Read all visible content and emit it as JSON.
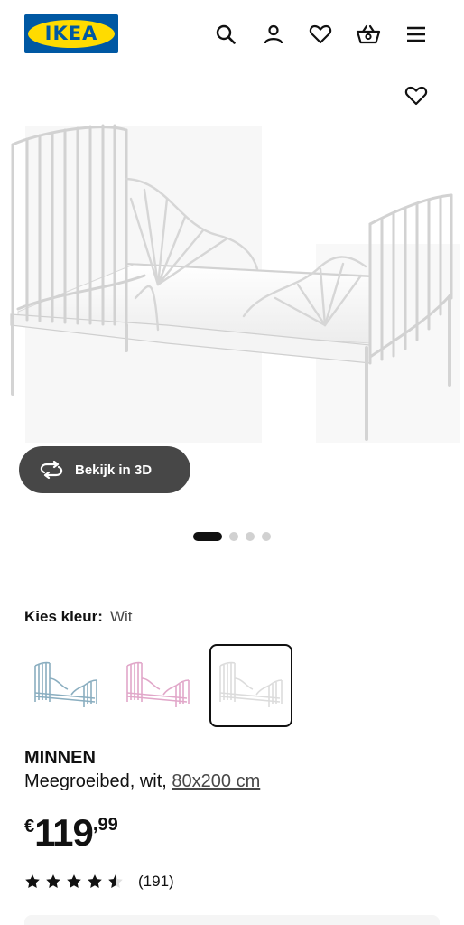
{
  "header": {
    "logo_text": "IKEA",
    "icons": [
      "search-icon",
      "account-icon",
      "heart-icon",
      "basket-icon",
      "menu-icon"
    ]
  },
  "gallery": {
    "image": "white-metal-extendable-bed",
    "view_3d_label": "Bekijk in 3D",
    "slide_count": 4,
    "active_slide": 1
  },
  "color": {
    "label": "Kies kleur:",
    "value": "Wit",
    "options": [
      {
        "name": "blauw",
        "hex": "#8aaec0"
      },
      {
        "name": "roze",
        "hex": "#e1a7c9"
      },
      {
        "name": "wit",
        "hex": "#e3e3e3",
        "selected": true
      }
    ]
  },
  "product": {
    "name": "MINNEN",
    "description": "Meegroeibed, wit, ",
    "size_link": "80x200 cm"
  },
  "price": {
    "currency": "€",
    "integer": "119",
    "decimals": ",99"
  },
  "rating": {
    "stars": 4.5,
    "count_text": "(191)"
  },
  "colors": {
    "ikea_blue": "#0058a3",
    "ikea_yellow": "#ffdb00",
    "button_dark": "#474747"
  }
}
